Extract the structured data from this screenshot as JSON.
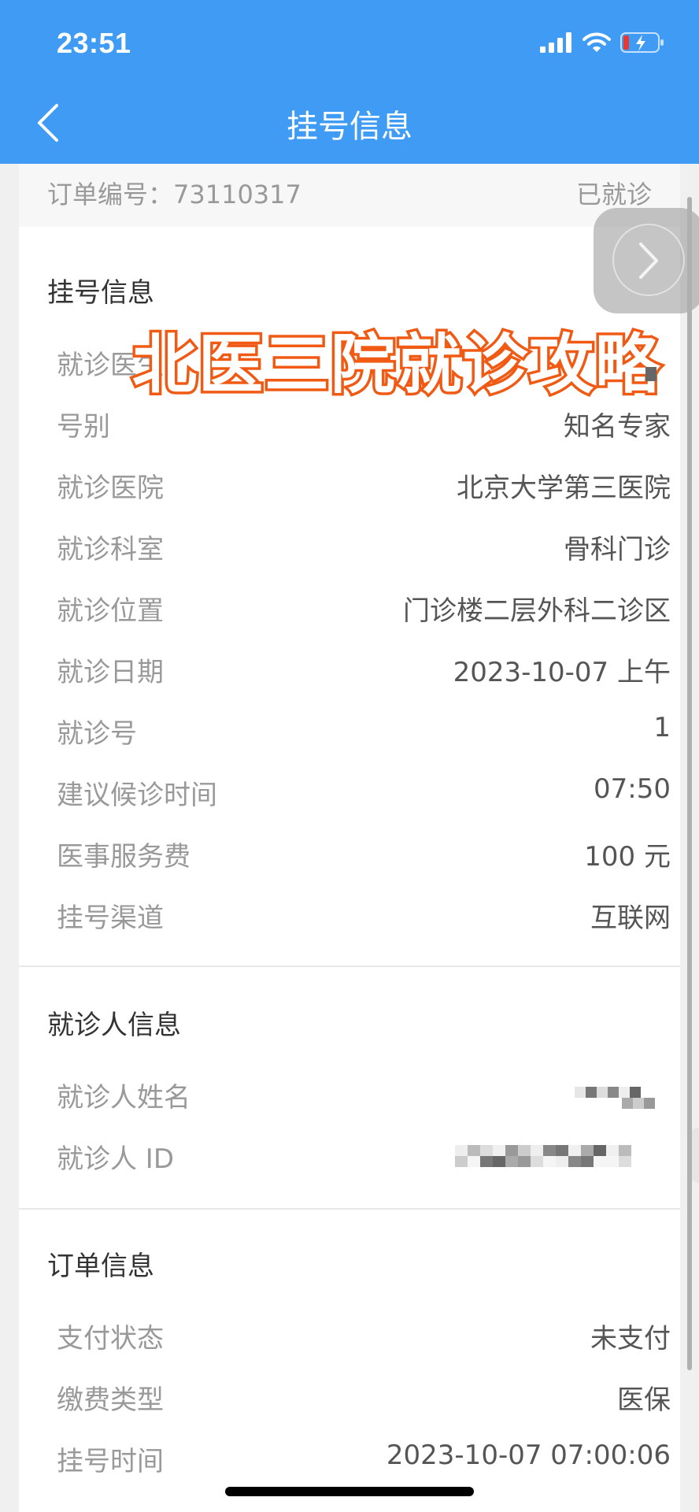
{
  "status_bar": {
    "time": "23:51"
  },
  "nav": {
    "title": "挂号信息"
  },
  "order_strip": {
    "order_no": "订单编号：73110317",
    "status": "已就诊"
  },
  "overlay": {
    "text": "北医三院就诊攻略"
  },
  "registration": {
    "title": "挂号信息",
    "rows": [
      {
        "k": "就诊医生",
        "v": ""
      },
      {
        "k": "号别",
        "v": "知名专家"
      },
      {
        "k": "就诊医院",
        "v": "北京大学第三医院"
      },
      {
        "k": "就诊科室",
        "v": "骨科门诊"
      },
      {
        "k": "就诊位置",
        "v": "门诊楼二层外科二诊区"
      },
      {
        "k": "就诊日期",
        "v": "2023-10-07 上午"
      },
      {
        "k": "就诊号",
        "v": "1"
      },
      {
        "k": "建议候诊时间",
        "v": "07:50"
      },
      {
        "k": "医事服务费",
        "v": "100 元"
      },
      {
        "k": "挂号渠道",
        "v": "互联网"
      }
    ]
  },
  "patient": {
    "title": "就诊人信息",
    "rows": [
      {
        "k": "就诊人姓名",
        "v": ""
      },
      {
        "k": "就诊人 ID",
        "v": ""
      }
    ]
  },
  "order": {
    "title": "订单信息",
    "rows": [
      {
        "k": "支付状态",
        "v": "未支付"
      },
      {
        "k": "缴费类型",
        "v": "医保"
      },
      {
        "k": "挂号时间",
        "v": "2023-10-07 07:00:06"
      }
    ]
  },
  "colors": {
    "primary": "#3f9bf4",
    "overlay_stroke": "#f05a14"
  },
  "icons": [
    "signal-icon",
    "wifi-icon",
    "battery-charging-icon",
    "back-chevron-icon",
    "chevron-right-icon"
  ]
}
